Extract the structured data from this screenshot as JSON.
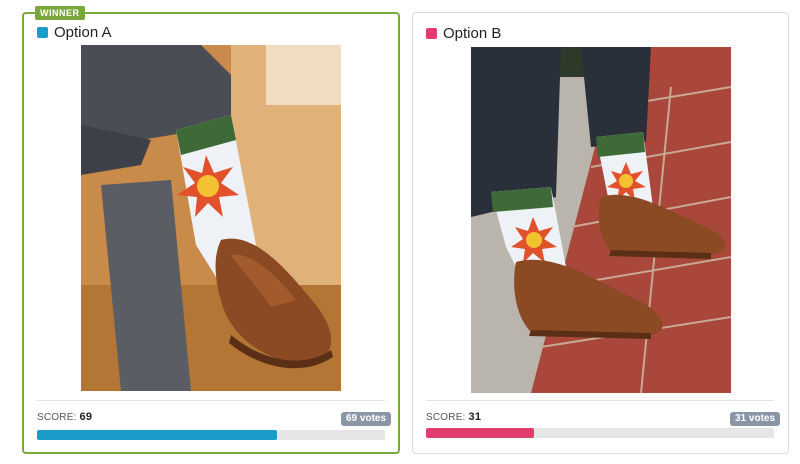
{
  "winner_label": "WINNER",
  "options": [
    {
      "title": "Option A",
      "color": "#1a9cc9",
      "score_label": "SCORE:",
      "score": "69",
      "score_fraction": 0.69,
      "votes": "69 votes",
      "image_desc": "crossed leg wearing sun socks and brown shoe"
    },
    {
      "title": "Option B",
      "color": "#e03c6c",
      "score_label": "SCORE:",
      "score": "31",
      "score_fraction": 0.31,
      "votes": "31 votes",
      "image_desc": "two feet wearing sun socks and brown shoes on brick sidewalk"
    }
  ]
}
